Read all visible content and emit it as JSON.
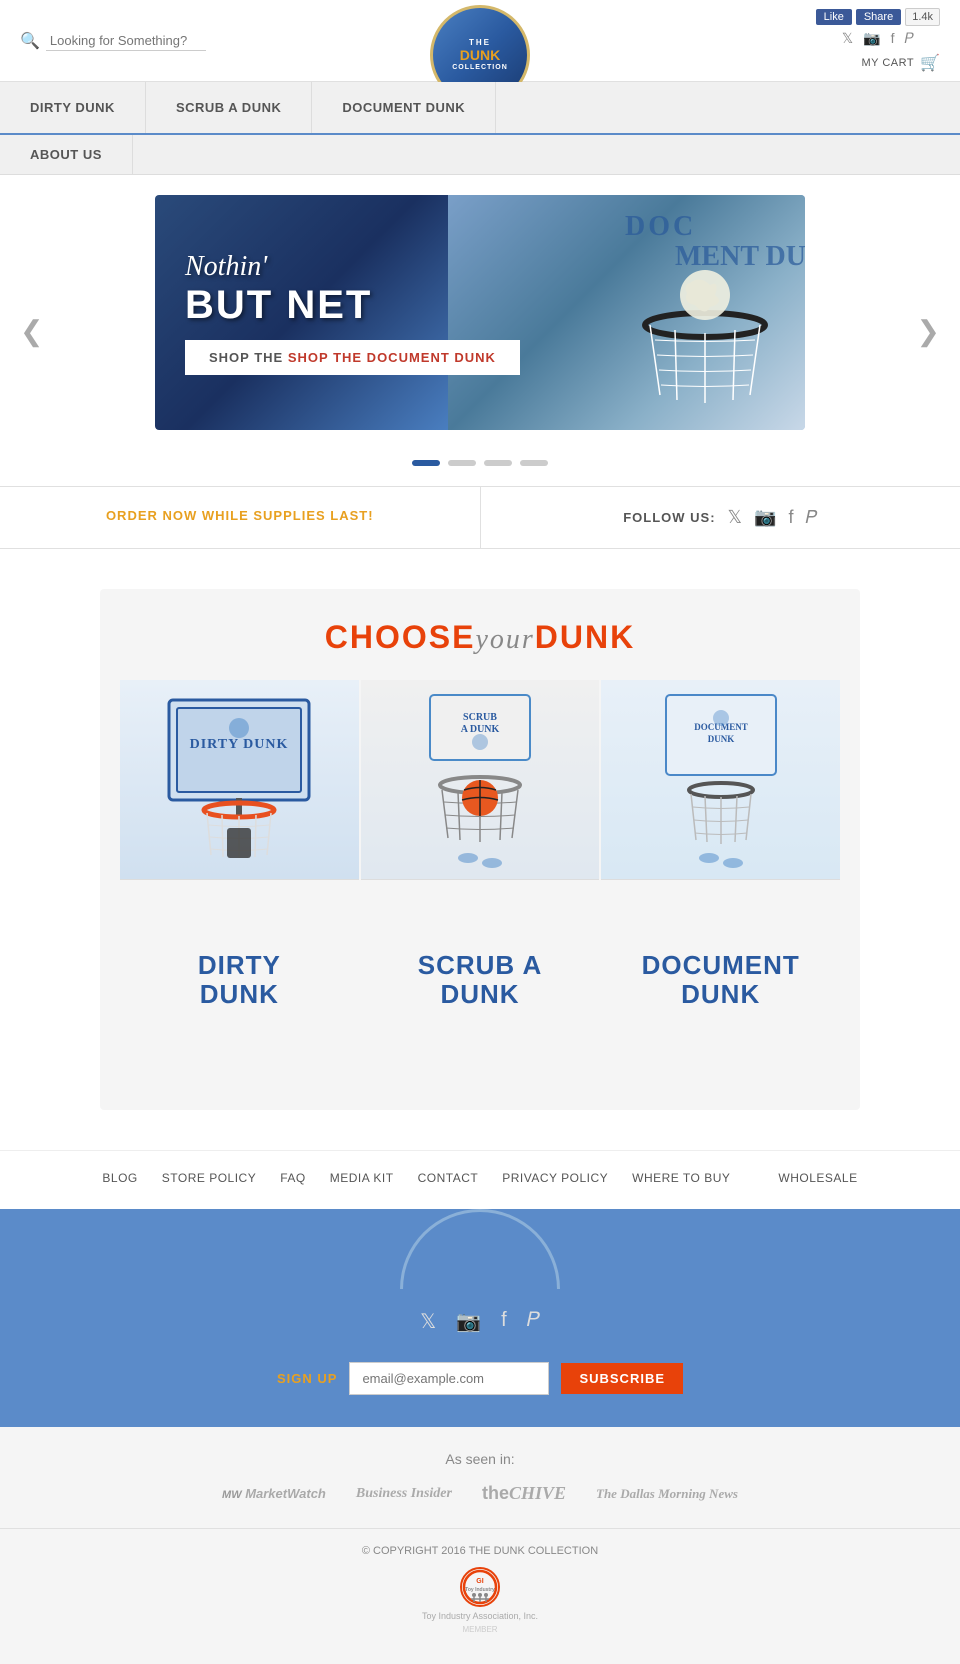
{
  "header": {
    "search_placeholder": "Looking for Something?",
    "fb_like": "Like",
    "fb_share": "Share",
    "fb_count": "1.4k",
    "cart_label": "MY CART",
    "logo_line1": "THE",
    "logo_dunk": "DUNK",
    "logo_line2": "COLLECTION"
  },
  "nav": {
    "items": [
      {
        "label": "DIRTY DUNK",
        "id": "dirty-dunk"
      },
      {
        "label": "SCRUB A DUNK",
        "id": "scrub-a-dunk"
      },
      {
        "label": "DOCUMENT DUNK",
        "id": "document-dunk"
      }
    ],
    "second_row": [
      {
        "label": "ABOUT US",
        "id": "about-us"
      }
    ]
  },
  "hero": {
    "slide1_text1": "Nothin'",
    "slide1_text2": "BUT NET",
    "slide1_btn": "SHOP THE DOCUMENT DUNK",
    "arrow_left": "❮",
    "arrow_right": "❯",
    "dots": [
      {
        "active": true
      },
      {
        "active": false
      },
      {
        "active": false
      },
      {
        "active": false
      }
    ]
  },
  "order_bar": {
    "order_text": "ORDER NOW WHILE SUPPLIES LAST!",
    "follow_label": "FOLLOW US:"
  },
  "choose": {
    "title_choose": "CHOOSE",
    "title_your": "your",
    "title_dunk": "DUNK",
    "products": [
      {
        "name_line1": "DIRTY",
        "name_line2": "DUNK",
        "class": "dirty-name",
        "id": "dirty-dunk-card"
      },
      {
        "name_line1": "SCRUB A",
        "name_line2": "DUNK",
        "class": "scrub-name",
        "id": "scrub-dunk-card"
      },
      {
        "name_line1": "DOCUMENT",
        "name_line2": "DUNK",
        "class": "doc-name",
        "id": "doc-dunk-card"
      }
    ]
  },
  "footer_links": [
    {
      "label": "BLOG",
      "id": "blog-link"
    },
    {
      "label": "STORE POLICY",
      "id": "store-policy-link"
    },
    {
      "label": "FAQ",
      "id": "faq-link"
    },
    {
      "label": "MEDIA KIT",
      "id": "media-kit-link"
    },
    {
      "label": "CONTACT",
      "id": "contact-link"
    },
    {
      "label": "PRIVACY POLICY",
      "id": "privacy-policy-link"
    },
    {
      "label": "WHERE TO BUY",
      "id": "where-to-buy-link"
    },
    {
      "label": "WHOLESALE",
      "id": "wholesale-link"
    }
  ],
  "footer": {
    "signup_label": "SIGN UP",
    "email_placeholder": "email@example.com",
    "subscribe_btn": "SUBSCRIBE"
  },
  "as_seen": {
    "title": "As seen in:",
    "logos": [
      {
        "name": "MarketWatch",
        "class": "marketwatch"
      },
      {
        "name": "Business Insider",
        "class": "business-insider"
      },
      {
        "name": "theCHIVE",
        "class": "thechive"
      },
      {
        "name": "The Dallas Morning News",
        "class": "dallas-morning"
      }
    ]
  },
  "copyright": {
    "text": "© COPYRIGHT 2016 THE DUNK COLLECTION",
    "toy_label": "Toy Industry Association, Inc.",
    "toy_abbr": "TIA"
  }
}
